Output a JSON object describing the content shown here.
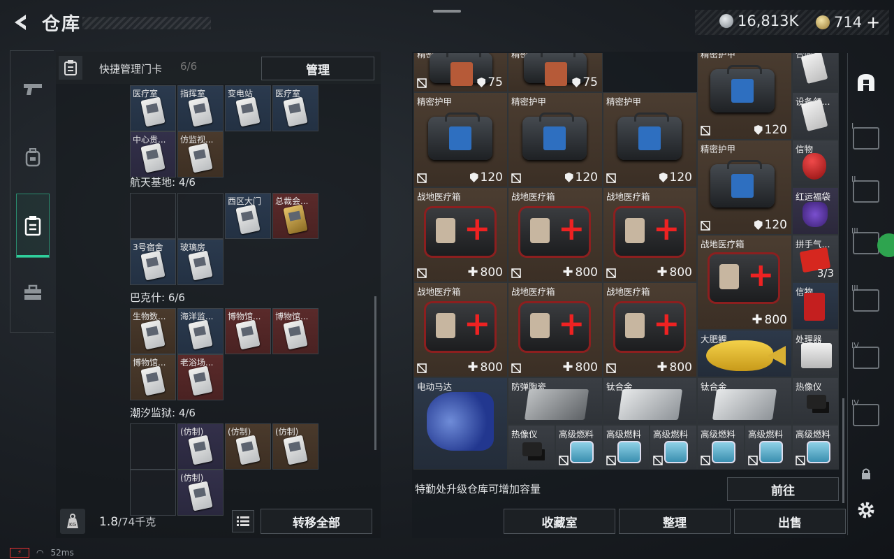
{
  "header": {
    "title": "仓库"
  },
  "currency": {
    "silver": "16,813K",
    "gold": "714",
    "plus": "+"
  },
  "left_panel": {
    "header_label": "快捷管理门卡",
    "header_count": "6/6",
    "manage_button": "管理",
    "sections": [
      {
        "name": "",
        "cells": [
          {
            "label": "医疗室",
            "color": "blue"
          },
          {
            "label": "指挥室",
            "color": "blue"
          },
          {
            "label": "变电站",
            "color": "blue"
          },
          {
            "label": "医疗室",
            "color": "blue"
          },
          {
            "label": "中心贵...",
            "color": "purple"
          },
          {
            "label": "仿监视...",
            "color": "brown"
          }
        ]
      },
      {
        "name": "航天基地: 4/6",
        "cells": [
          {
            "label": "",
            "color": "empty"
          },
          {
            "label": "",
            "color": "empty"
          },
          {
            "label": "西区大门",
            "color": "blue"
          },
          {
            "label": "总裁会...",
            "color": "red"
          },
          {
            "label": "3号宿舍",
            "color": "blue"
          },
          {
            "label": "玻璃房",
            "color": "blue"
          }
        ]
      },
      {
        "name": "巴克什: 6/6",
        "cells": [
          {
            "label": "生物数...",
            "color": "brown"
          },
          {
            "label": "海洋监...",
            "color": "blue"
          },
          {
            "label": "博物馆...",
            "color": "red"
          },
          {
            "label": "博物馆...",
            "color": "red"
          },
          {
            "label": "博物馆...",
            "color": "brown"
          },
          {
            "label": "老浴场...",
            "color": "red"
          }
        ]
      },
      {
        "name": "潮汐监狱: 4/6",
        "cells": [
          {
            "label": "",
            "color": "empty"
          },
          {
            "label": "(仿制)",
            "color": "purple"
          },
          {
            "label": "(仿制)",
            "color": "brown"
          },
          {
            "label": "(仿制)",
            "color": "brown"
          },
          {
            "label": "",
            "color": "empty"
          },
          {
            "label": "(仿制)",
            "color": "purple"
          }
        ]
      }
    ],
    "weight_current": "1.8",
    "weight_max": "/74千克",
    "transfer_button": "转移全部"
  },
  "right_panel": {
    "items": {
      "helmet1": {
        "label": "精密头盔",
        "value": "75"
      },
      "helmet2": {
        "label": "精密头盔",
        "value": "75"
      },
      "armor_a": {
        "label": "精密护甲",
        "value": "120"
      },
      "armor1": {
        "label": "精密护甲",
        "value": "120"
      },
      "armor2": {
        "label": "精密护甲",
        "value": "120"
      },
      "armor3": {
        "label": "精密护甲",
        "value": "120"
      },
      "armor_b": {
        "label": "精密护甲",
        "value": "120"
      },
      "doc1": {
        "label": "设备领..."
      },
      "doc0": {
        "label": "合同..."
      },
      "mask": {
        "label": "信物"
      },
      "pouch": {
        "label": "红运福袋"
      },
      "envelope": {
        "label": "拼手气...",
        "value": "3/3"
      },
      "redbook": {
        "label": "信物"
      },
      "processor": {
        "label": "处理器"
      },
      "med1": {
        "label": "战地医疗箱",
        "value": "800"
      },
      "med2": {
        "label": "战地医疗箱",
        "value": "800"
      },
      "med3": {
        "label": "战地医疗箱",
        "value": "800"
      },
      "med4": {
        "label": "战地医疗箱",
        "value": "800"
      },
      "med5": {
        "label": "战地医疗箱",
        "value": "800"
      },
      "med6": {
        "label": "战地医疗箱",
        "value": "800"
      },
      "med7": {
        "label": "战地医疗箱",
        "value": "800"
      },
      "fish": {
        "label": "大肥鲤"
      },
      "motor": {
        "label": "电动马达"
      },
      "ceramic": {
        "label": "防弹陶瓷"
      },
      "ti1": {
        "label": "钛合金"
      },
      "ti2": {
        "label": "钛合金"
      },
      "thermal1": {
        "label": "热像仪"
      },
      "thermal2": {
        "label": "热像仪"
      },
      "fuel1": {
        "label": "高级燃料"
      },
      "fuel2": {
        "label": "高级燃料"
      },
      "fuel3": {
        "label": "高级燃料"
      },
      "fuel4": {
        "label": "高级燃料"
      },
      "fuel5": {
        "label": "高级燃料"
      },
      "fuel6": {
        "label": "高级燃料"
      }
    },
    "upgrade_text": "特勤处升级仓库可增加容量",
    "go_button": "前往",
    "buttons": {
      "collection": "收藏室",
      "organize": "整理",
      "sell": "出售"
    }
  },
  "right_nav": {
    "tabs": [
      "I",
      "II",
      "III",
      "III",
      "IV",
      "IV"
    ]
  },
  "status": {
    "ping": "52ms"
  }
}
